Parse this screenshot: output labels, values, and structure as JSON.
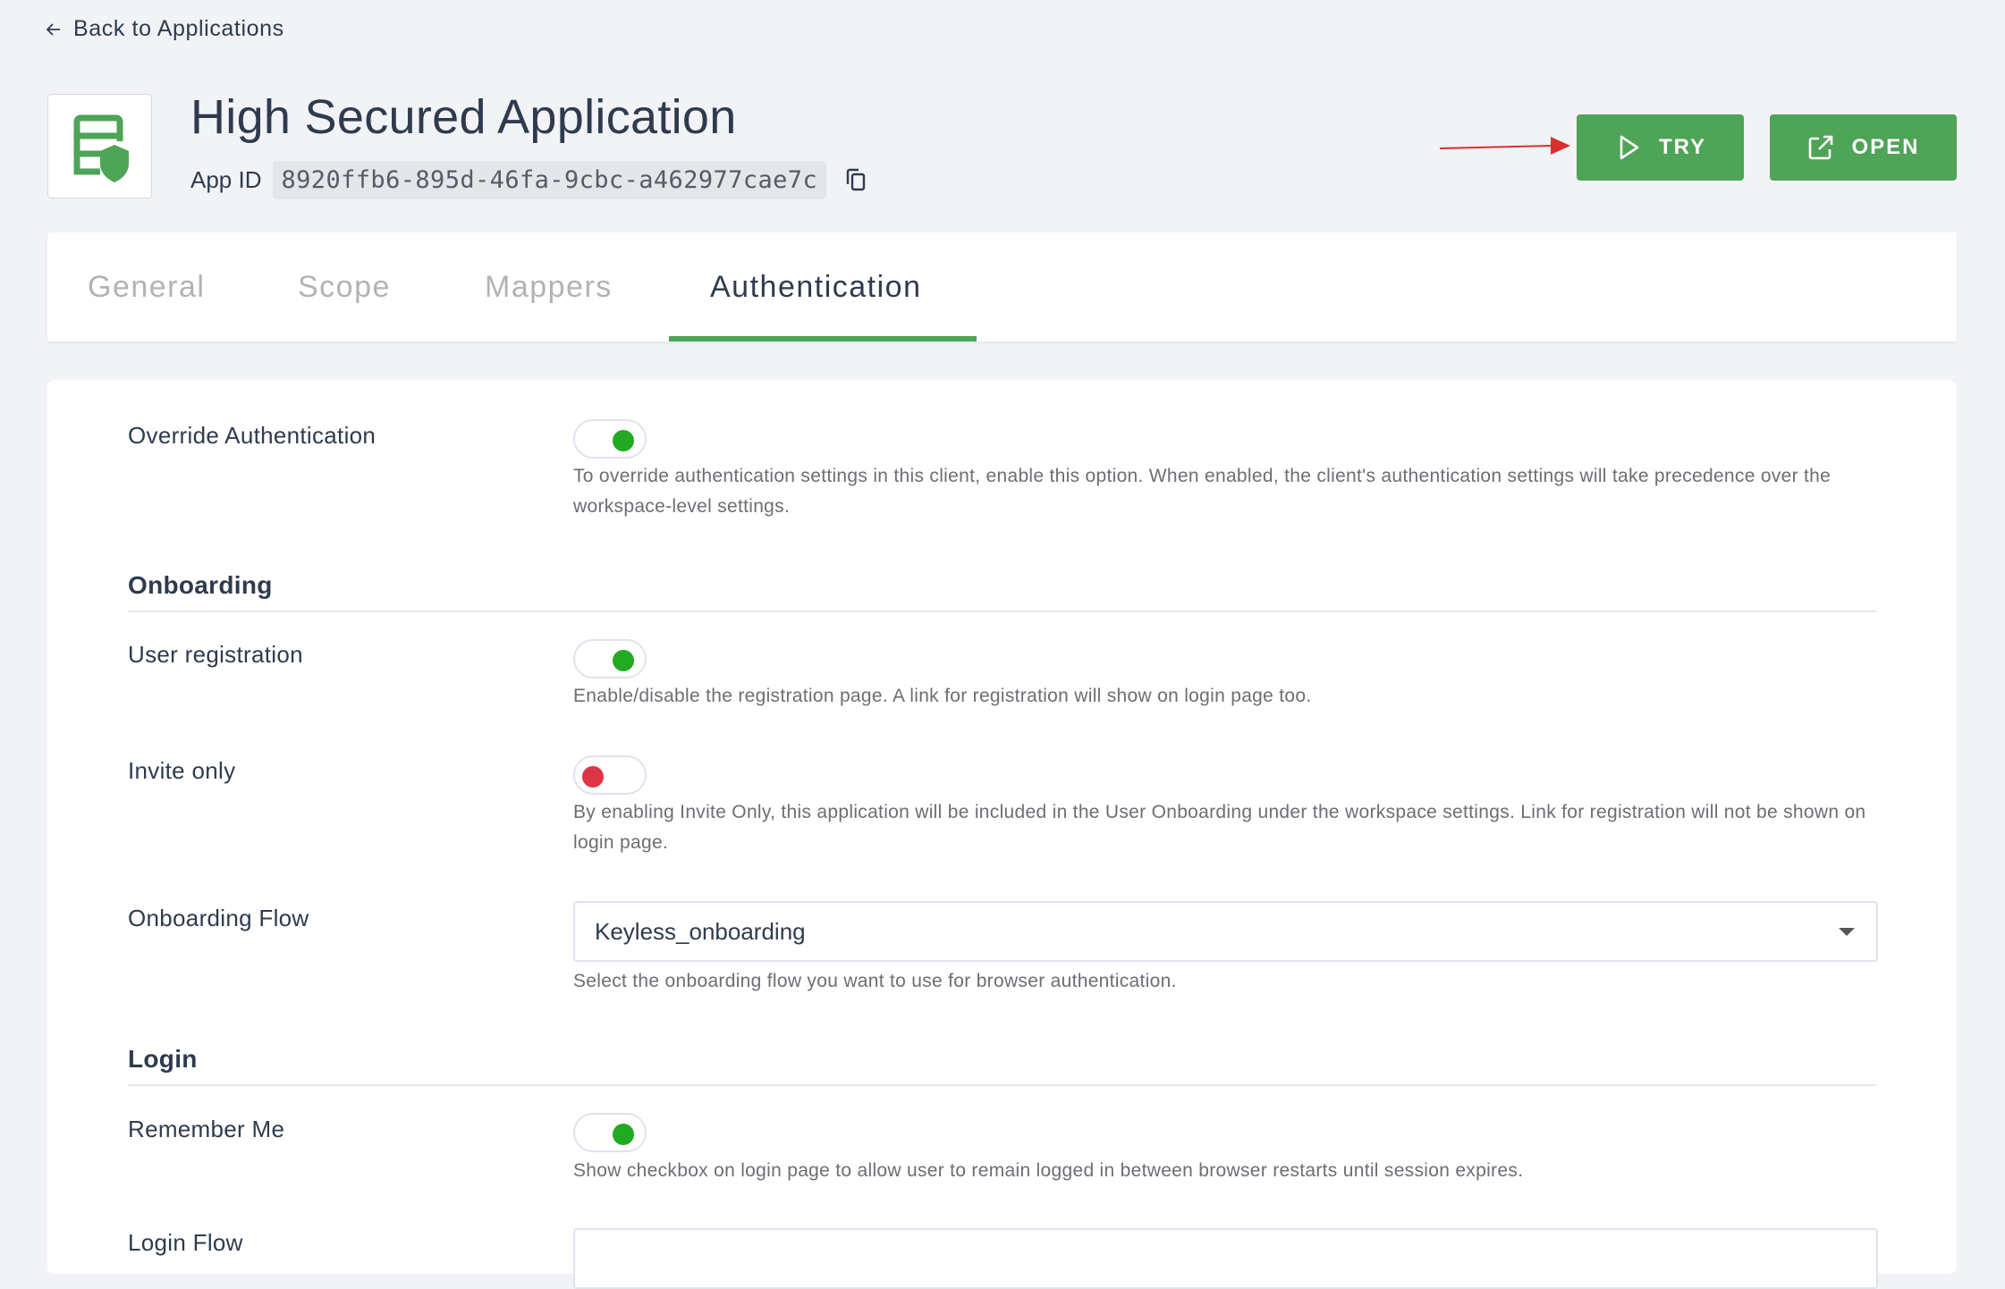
{
  "nav": {
    "back_label": "Back to Applications"
  },
  "app": {
    "title": "High Secured Application",
    "app_id_label": "App ID",
    "app_id": "8920ffb6-895d-46fa-9cbc-a462977cae7c",
    "logo_icon": "app-shield-icon"
  },
  "actions": {
    "try_label": "TRY",
    "open_label": "OPEN",
    "accent_color": "#4ea457",
    "annotation_arrow_color": "#d9302e"
  },
  "tabs": [
    {
      "label": "General",
      "active": false
    },
    {
      "label": "Scope",
      "active": false
    },
    {
      "label": "Mappers",
      "active": false
    },
    {
      "label": "Authentication",
      "active": true
    }
  ],
  "settings": {
    "override": {
      "label": "Override Authentication",
      "enabled": true,
      "description": "To override authentication settings in this client, enable this option. When enabled, the client's authentication settings will take precedence over the workspace-level settings."
    },
    "onboarding": {
      "heading": "Onboarding",
      "user_registration": {
        "label": "User registration",
        "enabled": true,
        "description": "Enable/disable the registration page. A link for registration will show on login page too."
      },
      "invite_only": {
        "label": "Invite only",
        "enabled": false,
        "description": "By enabling Invite Only, this application will be included in the User Onboarding under the workspace settings. Link for registration will not be shown on login page."
      },
      "onboarding_flow": {
        "label": "Onboarding Flow",
        "value": "Keyless_onboarding",
        "description": "Select the onboarding flow you want to use for browser authentication."
      }
    },
    "login": {
      "heading": "Login",
      "remember_me": {
        "label": "Remember Me",
        "enabled": true,
        "description": "Show checkbox on login page to allow user to remain logged in between browser restarts until session expires."
      },
      "login_flow": {
        "label": "Login Flow"
      }
    }
  },
  "colors": {
    "toggle_on": "#22aa22",
    "toggle_off": "#dc3545"
  }
}
